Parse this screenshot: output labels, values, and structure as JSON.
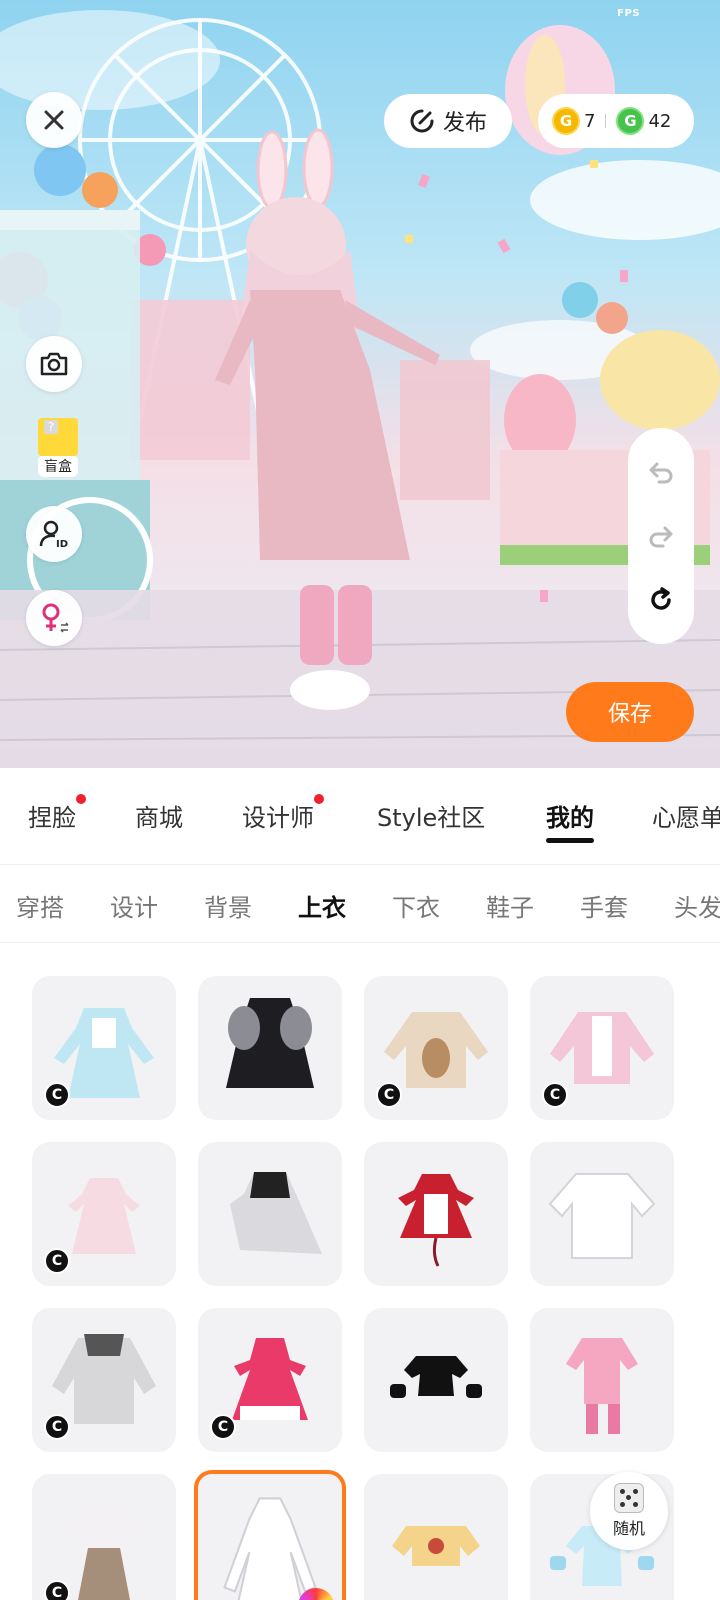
{
  "status": {
    "fps_label": "FPS"
  },
  "topbar": {
    "publish_label": "发布",
    "currency": [
      {
        "icon": "gold-coin-icon",
        "symbol": "G",
        "value": "7"
      },
      {
        "icon": "green-coin-icon",
        "symbol": "G",
        "value": "42"
      }
    ]
  },
  "side": {
    "blindbox_label": "盲盒"
  },
  "actions": {
    "save_label": "保存"
  },
  "main_tabs": [
    {
      "label": "捏脸",
      "dot": true
    },
    {
      "label": "商城",
      "dot": false
    },
    {
      "label": "设计师",
      "dot": true
    },
    {
      "label": "Style社区",
      "dot": false
    },
    {
      "label": "我的",
      "dot": false,
      "active": true
    },
    {
      "label": "心愿单",
      "dot": false
    }
  ],
  "sub_tabs": [
    {
      "label": "穿搭"
    },
    {
      "label": "设计"
    },
    {
      "label": "背景"
    },
    {
      "label": "上衣",
      "active": true
    },
    {
      "label": "下衣"
    },
    {
      "label": "鞋子"
    },
    {
      "label": "手套"
    },
    {
      "label": "头发"
    }
  ],
  "items": [
    {
      "name": "light-blue-maid-dress",
      "badge": "C",
      "selected": false
    },
    {
      "name": "black-gothic-coat",
      "badge": "",
      "selected": false
    },
    {
      "name": "beige-bear-sweater",
      "badge": "C",
      "selected": false
    },
    {
      "name": "pink-ruffle-jacket",
      "badge": "C",
      "selected": false
    },
    {
      "name": "pink-puff-dress",
      "badge": "C",
      "selected": false
    },
    {
      "name": "black-white-lolita",
      "badge": "",
      "selected": false
    },
    {
      "name": "red-white-maid-dress",
      "badge": "",
      "selected": false
    },
    {
      "name": "white-tshirt",
      "badge": "",
      "selected": false
    },
    {
      "name": "grey-hoodie",
      "badge": "C",
      "selected": false
    },
    {
      "name": "pink-flower-dress",
      "badge": "C",
      "selected": false
    },
    {
      "name": "black-crop-top",
      "badge": "",
      "selected": false
    },
    {
      "name": "pink-idol-outfit",
      "badge": "",
      "selected": false
    },
    {
      "name": "plaid-school-uniform",
      "badge": "C",
      "selected": false
    },
    {
      "name": "white-long-dress",
      "badge": "",
      "selected": true,
      "color_wheel": true
    },
    {
      "name": "cookie-outfit",
      "badge": "",
      "selected": false
    },
    {
      "name": "blue-sailor-outfit",
      "badge": "",
      "selected": false
    }
  ],
  "random": {
    "label": "随机"
  },
  "colors": {
    "accent": "#ff7a1a",
    "tab_dot": "#f0202e",
    "gold": "#f5b800",
    "green": "#47c24d"
  }
}
